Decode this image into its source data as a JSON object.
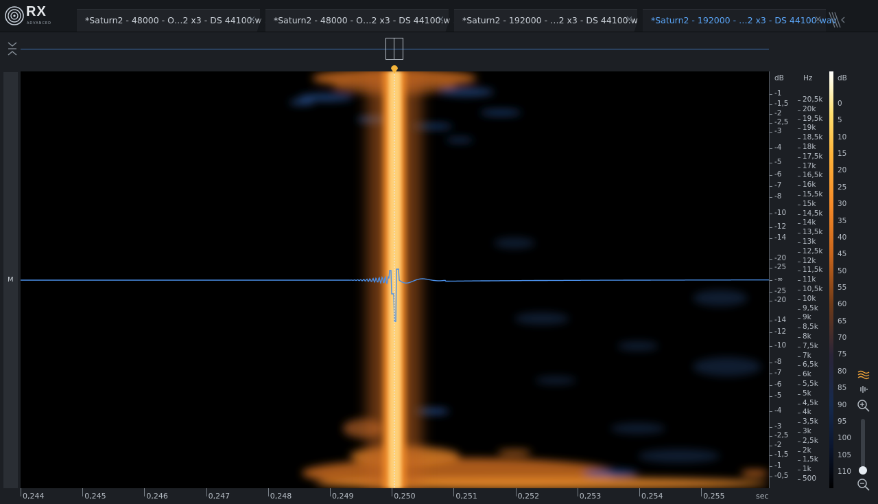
{
  "app": {
    "logo_text": "RX",
    "logo_sub": "ADVANCED"
  },
  "tabs": [
    {
      "label": "*Saturn2 - 48000 - O…2 x3 - DS 44100.wav",
      "active": false
    },
    {
      "label": "*Saturn2 - 48000 - O…2 x3 - DS 44100.wav",
      "active": false
    },
    {
      "label": "*Saturn2 - 192000 - …2 x3 - DS 44100.wav",
      "active": false
    },
    {
      "label": "*Saturn2 - 192000 - …2 x3 - DS 44100.wav",
      "active": true
    }
  ],
  "tab_close_glyph": "×",
  "channel_label": "M",
  "db_ruler": {
    "unit": "dB",
    "ticks": [
      "-1",
      "-1,5",
      "-2",
      "-2,5",
      "-3",
      "-4",
      "-5",
      "-6",
      "-7",
      "-8",
      "-10",
      "-12",
      "-14",
      "-20",
      "-25",
      "-∞",
      "-25",
      "-20",
      "-14",
      "-12",
      "-10",
      "-8",
      "-7",
      "-6",
      "-5",
      "-4",
      "-3",
      "-2,5",
      "-2",
      "-1,5",
      "-1",
      "-0,5"
    ]
  },
  "hz_ruler": {
    "unit": "Hz",
    "ticks": [
      "20,5k",
      "20k",
      "19,5k",
      "19k",
      "18,5k",
      "18k",
      "17,5k",
      "17k",
      "16,5k",
      "16k",
      "15,5k",
      "15k",
      "14,5k",
      "14k",
      "13,5k",
      "13k",
      "12,5k",
      "12k",
      "11,5k",
      "11k",
      "10,5k",
      "10k",
      "9,5k",
      "9k",
      "8,5k",
      "8k",
      "7,5k",
      "7k",
      "6,5k",
      "6k",
      "5,5k",
      "5k",
      "4,5k",
      "4k",
      "3,5k",
      "3k",
      "2,5k",
      "2k",
      "1,5k",
      "1k",
      "500"
    ]
  },
  "color_scale": {
    "unit": "dB",
    "ticks": [
      "0",
      "5",
      "10",
      "15",
      "20",
      "25",
      "30",
      "35",
      "40",
      "45",
      "50",
      "55",
      "60",
      "65",
      "70",
      "75",
      "80",
      "85",
      "90",
      "95",
      "100",
      "105",
      "110"
    ]
  },
  "time_ruler": {
    "unit": "sec",
    "ticks": [
      "0,244",
      "0,245",
      "0,246",
      "0,247",
      "0,248",
      "0,249",
      "0,250",
      "0,251",
      "0,252",
      "0,253",
      "0,254",
      "0,255"
    ]
  },
  "colors": {
    "accent": "#5aa4f5",
    "waveform": "#4a8fe8",
    "playhead_marker": "#f4b43a",
    "spectrum_hot": "#ffd27a",
    "spectrum_mid": "#f08c2a",
    "spectrum_low": "#1e3458"
  },
  "icons": {
    "logo": "rx-logo-icon",
    "collapse": "collapse-chevrons-icon",
    "overflow": "tab-overflow-icon",
    "spectrogram_mode": "spectrogram-mode-icon",
    "waveform_mode": "waveform-mode-icon",
    "zoom_in": "zoom-in-icon",
    "zoom_out": "zoom-out-icon"
  },
  "zoom_slider_value": 0.08
}
